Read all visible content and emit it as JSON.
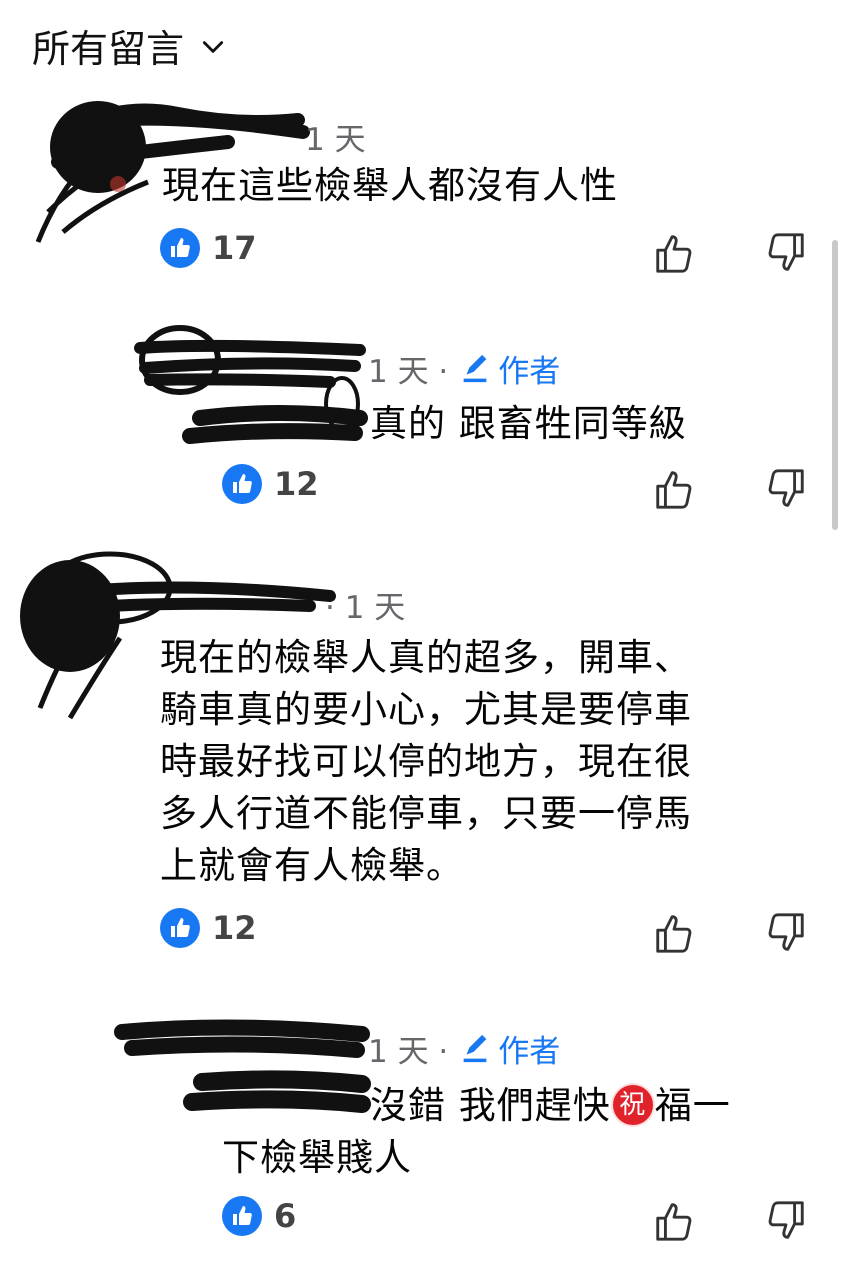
{
  "header": {
    "title": "所有留言",
    "chevron_icon": "chevron-down-icon"
  },
  "comments": [
    {
      "meta": {
        "time": "1 天"
      },
      "text": "現在這些檢舉人都沒有人性",
      "like_count": "17"
    },
    {
      "meta": {
        "time": "1 天 ·",
        "author_label": "作者"
      },
      "text": "真的 跟畜牲同等級",
      "like_count": "12"
    },
    {
      "meta": {
        "time": "· 1 天"
      },
      "text": "現在的檢舉人真的超多，開車、\n騎車真的要小心，尤其是要停車\n時最好找可以停的地方，現在很\n多人行道不能停車，只要一停馬\n上就會有人檢舉。",
      "like_count": "12"
    },
    {
      "meta": {
        "time": "1 天 ·",
        "author_label": "作者"
      },
      "text_before": "沒錯 我們趕快",
      "emoji_char": "祝",
      "text_after": "福一",
      "text_line2": "下檢舉賤人",
      "like_count": "6"
    }
  ],
  "colors": {
    "accent": "#1877f2",
    "meta": "#65676b",
    "text": "#050505"
  }
}
